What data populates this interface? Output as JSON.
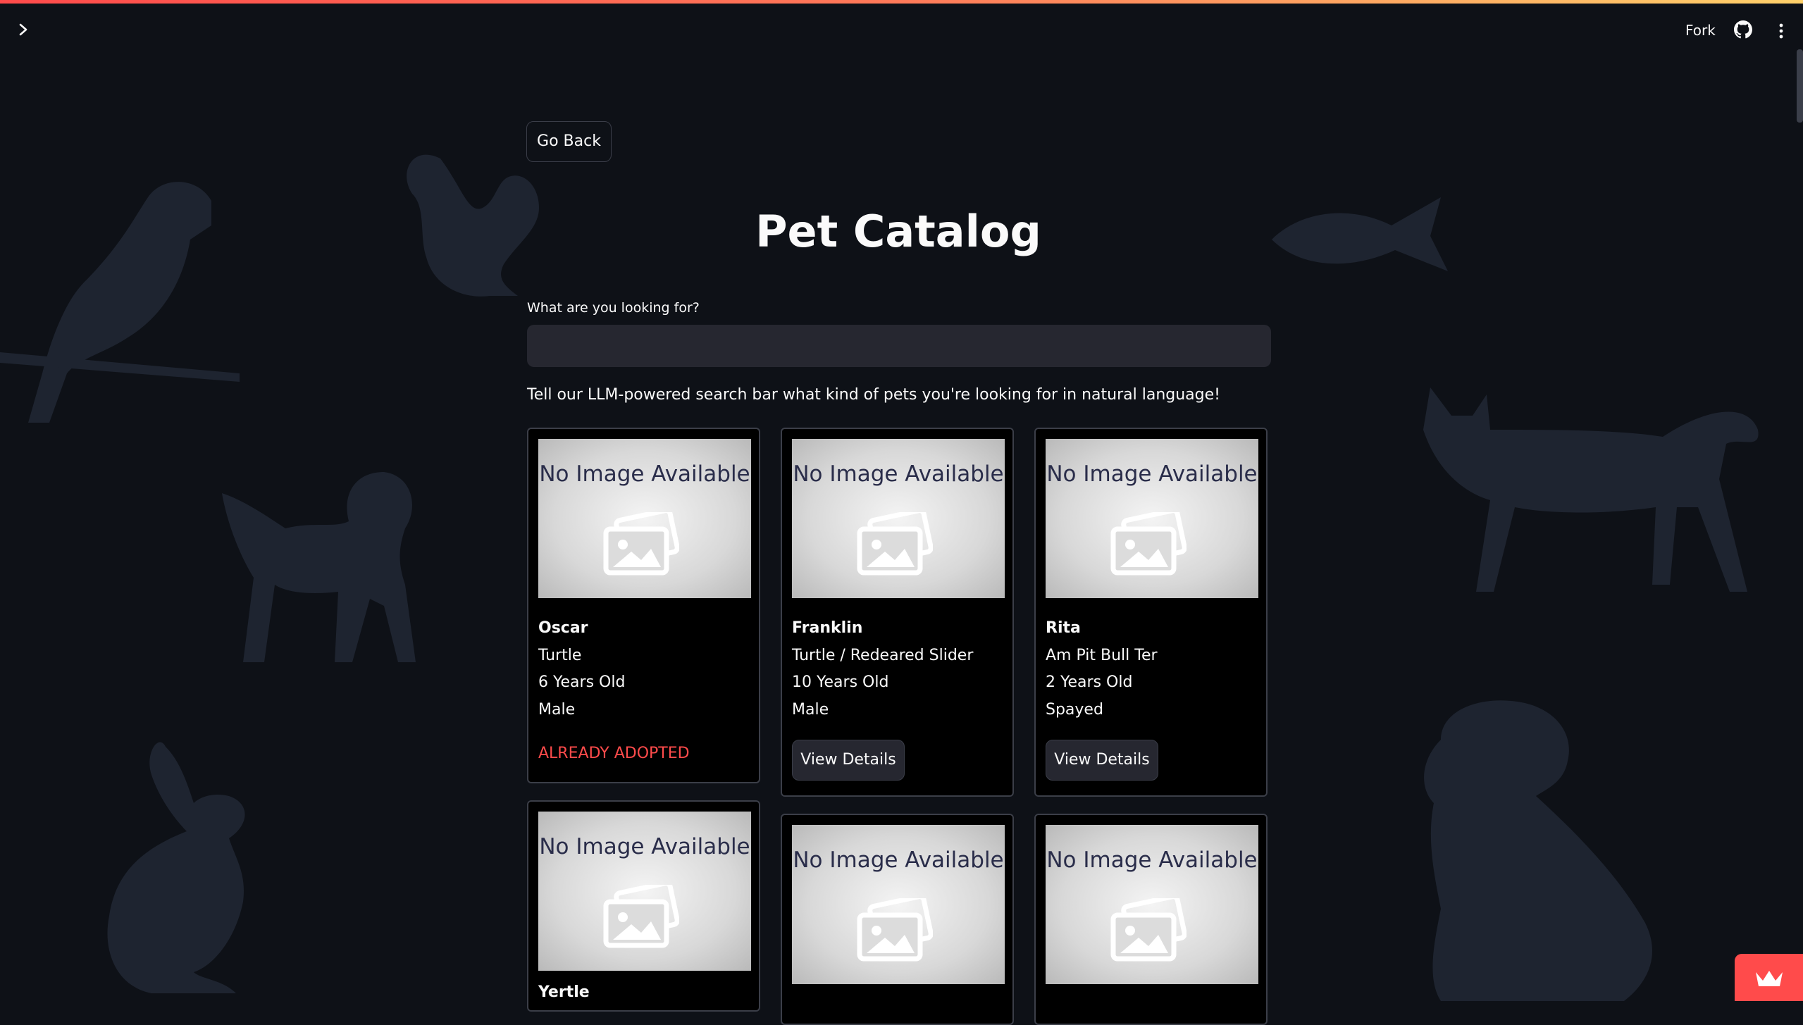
{
  "header": {
    "sidebar_toggle": "›",
    "fork_label": "Fork",
    "github_icon": "github-icon",
    "menu_icon": "kebab-menu-icon"
  },
  "nav": {
    "go_back": "Go Back"
  },
  "title": "Pet Catalog",
  "search": {
    "label": "What are you looking for?",
    "value": "",
    "placeholder": ""
  },
  "hint": "Tell our LLM-powered search bar what kind of pets you're looking for in natural language!",
  "placeholder_image_text": "No Image Available",
  "pets": [
    {
      "name": "Oscar",
      "breed": "Turtle",
      "age": "6 Years Old",
      "sex": "Male",
      "status": "ALREADY ADOPTED"
    },
    {
      "name": "Franklin",
      "breed": "Turtle / Redeared Slider",
      "age": "10 Years Old",
      "sex": "Male",
      "action": "View Details"
    },
    {
      "name": "Rita",
      "breed": "Am Pit Bull Ter",
      "age": "2 Years Old",
      "sex": "Spayed",
      "action": "View Details"
    },
    {
      "name": "Yertle"
    }
  ],
  "colors": {
    "background": "#0e1117",
    "card": "#000000",
    "accent": "#ff4b4b",
    "input": "#262730",
    "silhouette": "#1e2430"
  }
}
